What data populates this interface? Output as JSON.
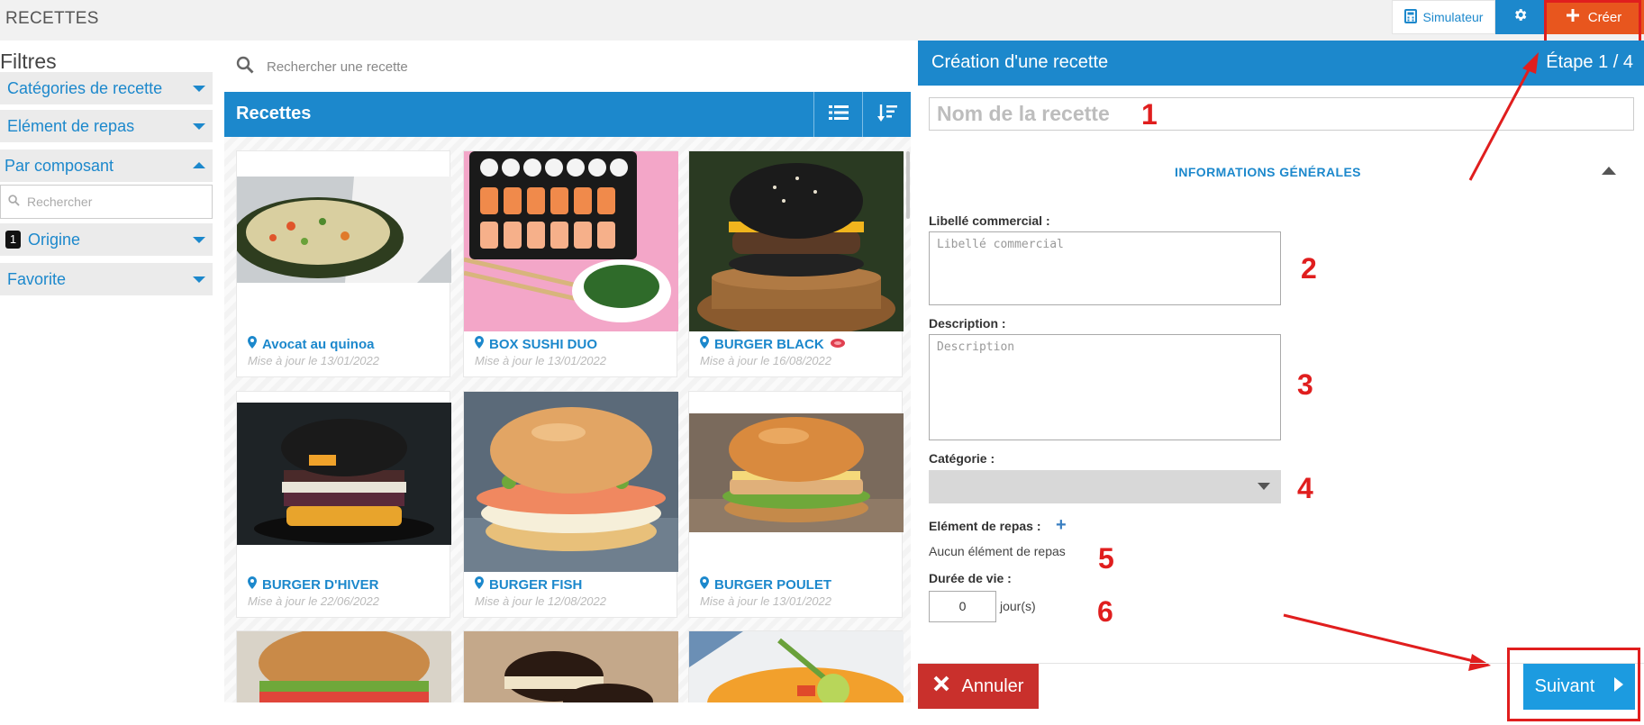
{
  "app": {
    "title": "RECETTES"
  },
  "toolbar": {
    "simulateur_label": "Simulateur",
    "creer_label": "Créer"
  },
  "filters": {
    "title": "Filtres",
    "items": [
      {
        "label": "Catégories de recette"
      },
      {
        "label": "Elément de repas"
      },
      {
        "label": "Par composant"
      },
      {
        "label": "Origine",
        "badge": "1"
      },
      {
        "label": "Favorite"
      }
    ],
    "search_placeholder": "Rechercher"
  },
  "recipe_search": {
    "placeholder": "Rechercher une recette"
  },
  "list": {
    "title": "Recettes",
    "cards": [
      {
        "name": "Avocat au quinoa",
        "updated": "Mise à jour le 13/01/2022"
      },
      {
        "name": "BOX SUSHI DUO",
        "updated": "Mise à jour le 13/01/2022"
      },
      {
        "name": "BURGER BLACK",
        "updated": "Mise à jour le 16/08/2022"
      },
      {
        "name": "BURGER D'HIVER",
        "updated": "Mise à jour le 22/06/2022"
      },
      {
        "name": "BURGER FISH",
        "updated": "Mise à jour le 12/08/2022"
      },
      {
        "name": "BURGER POULET",
        "updated": "Mise à jour le 13/01/2022"
      }
    ]
  },
  "panel": {
    "title": "Création d'une recette",
    "step": "Étape 1 / 4",
    "name_placeholder": "Nom de la recette",
    "section_title": "INFORMATIONS GÉNÉRALES",
    "libelle_label": "Libellé commercial :",
    "libelle_placeholder": "Libellé commercial",
    "description_label": "Description :",
    "description_placeholder": "Description",
    "categorie_label": "Catégorie :",
    "element_label": "Elément de repas :",
    "element_empty": "Aucun élément de repas",
    "duree_label": "Durée de vie :",
    "duree_value": "0",
    "duree_unit": "jour(s)",
    "annuler_label": "Annuler",
    "suivant_label": "Suivant"
  },
  "annotations": [
    "1",
    "2",
    "3",
    "4",
    "5",
    "6"
  ],
  "colors": {
    "primary": "#1c88cc",
    "create": "#e8561e",
    "cancel": "#c9302c",
    "next": "#1c9be0",
    "annotation": "#e01e1e"
  }
}
